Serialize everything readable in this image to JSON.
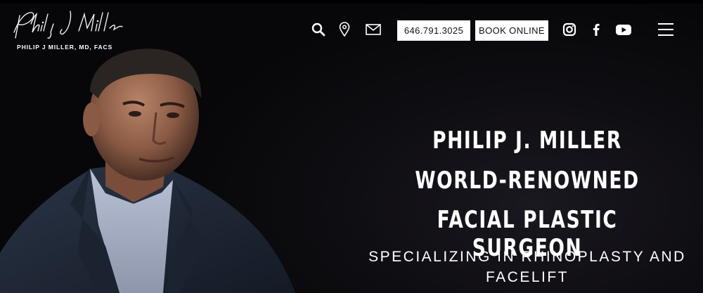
{
  "header": {
    "logo_signature": "Philip J Miller",
    "logo_subtitle": "PHILIP J MILLER, MD, FACS",
    "phone_label": "646.791.3025",
    "book_label": "BOOK ONLINE"
  },
  "icons": {
    "search": "search-icon",
    "location": "location-pin-icon",
    "mail": "mail-icon",
    "instagram": "instagram-icon",
    "facebook": "facebook-icon",
    "youtube": "youtube-icon",
    "menu": "menu-icon"
  },
  "hero": {
    "headline_lines": [
      "PHILIP J. MILLER",
      "WORLD-RENOWNED",
      "FACIAL PLASTIC SURGEON"
    ],
    "subheadline": "SPECIALIZING IN RHINOPLASTY AND FACELIFT"
  },
  "colors": {
    "background": "#0b0a0d",
    "button_bg": "#ffffff",
    "button_text": "#111111",
    "text": "#ffffff"
  }
}
